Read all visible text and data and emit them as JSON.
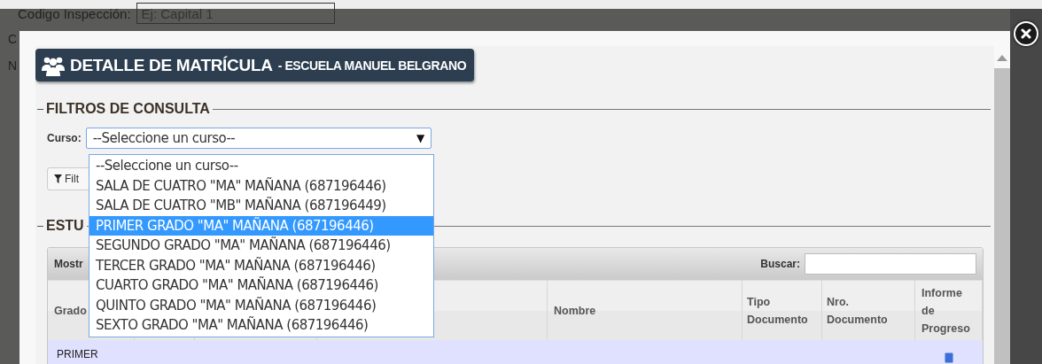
{
  "background": {
    "edge_letters": [
      "C",
      "N"
    ],
    "inspection_code": {
      "label": "Codigo Inspección:",
      "placeholder": "Ej: Capital 1"
    }
  },
  "dialog": {
    "title": "DETALLE DE MATRÍCULA",
    "subtitle": "- ESCUELA MANUEL BELGRANO",
    "filters": {
      "legend": "FILTROS DE CONSULTA",
      "course_label": "Curso:",
      "course_value": "--Seleccione un curso--",
      "dropdown_arrow": "▼",
      "filter_button": "Filt",
      "options": [
        {
          "label": "--Seleccione un curso--",
          "selected": false
        },
        {
          "label": "SALA DE CUATRO \"MA\" MAÑANA (687196446)",
          "selected": false
        },
        {
          "label": "SALA DE CUATRO \"MB\" MAÑANA (687196449)",
          "selected": false
        },
        {
          "label": "PRIMER GRADO \"MA\" MAÑANA (687196446)",
          "selected": true
        },
        {
          "label": "SEGUNDO GRADO \"MA\" MAÑANA (687196446)",
          "selected": false
        },
        {
          "label": "TERCER GRADO \"MA\" MAÑANA (687196446)",
          "selected": false
        },
        {
          "label": "CUARTO GRADO \"MA\" MAÑANA (687196446)",
          "selected": false
        },
        {
          "label": "QUINTO GRADO \"MA\" MAÑANA (687196446)",
          "selected": false
        },
        {
          "label": "SEXTO GRADO \"MA\" MAÑANA (687196446)",
          "selected": false
        }
      ]
    },
    "students": {
      "legend": "ESTU",
      "show_label": "Mostr",
      "search_label": "Buscar:",
      "columns": [
        {
          "label": "Grado"
        },
        {},
        {},
        {},
        {
          "label": "Nombre"
        },
        {
          "label": "Tipo Documento"
        },
        {
          "label": "Nro. Documento"
        },
        {
          "label": "Informe de Progreso"
        }
      ],
      "rows": [
        {
          "cells": [
            "PRIMER"
          ]
        }
      ]
    }
  }
}
